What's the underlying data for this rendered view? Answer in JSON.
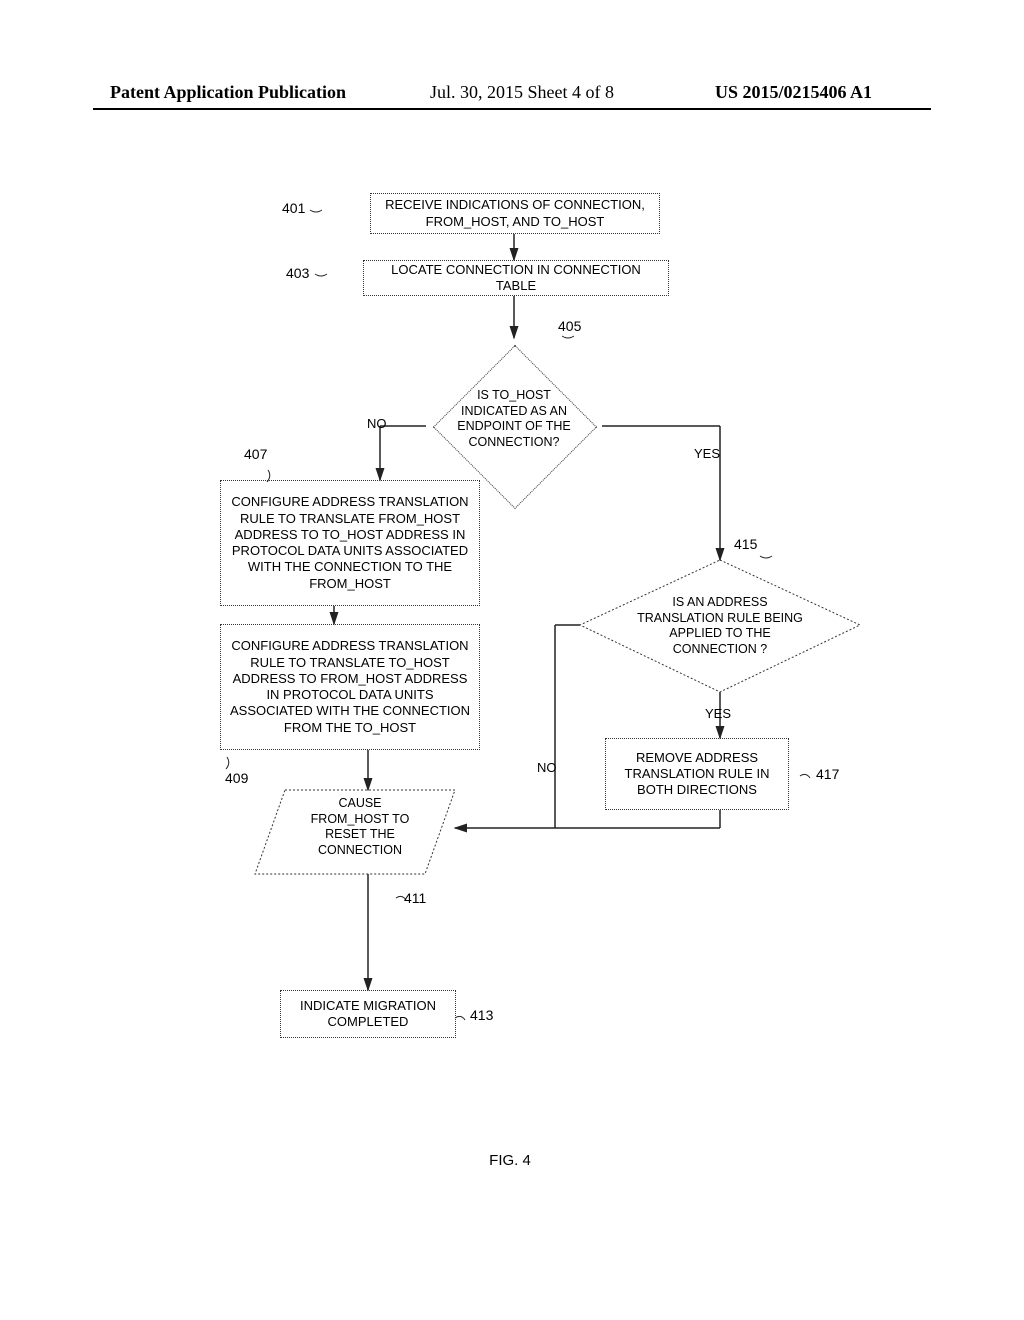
{
  "header": {
    "left": "Patent Application Publication",
    "mid": "Jul. 30, 2015  Sheet 4 of 8",
    "right": "US 2015/0215406 A1"
  },
  "refs": {
    "r401": "401",
    "r403": "403",
    "r405": "405",
    "r407": "407",
    "r409": "409",
    "r411": "411",
    "r413": "413",
    "r415": "415",
    "r417": "417"
  },
  "labels": {
    "no1": "NO",
    "yes1": "YES",
    "no2": "NO",
    "yes2": "YES"
  },
  "boxes": {
    "b401": "RECEIVE INDICATIONS OF CONNECTION, FROM_HOST, AND TO_HOST",
    "b403": "LOCATE CONNECTION IN CONNECTION TABLE",
    "b407": "CONFIGURE ADDRESS TRANSLATION RULE TO TRANSLATE FROM_HOST ADDRESS TO TO_HOST ADDRESS IN PROTOCOL DATA UNITS ASSOCIATED WITH THE CONNECTION TO THE FROM_HOST",
    "b409": "CONFIGURE ADDRESS TRANSLATION RULE TO TRANSLATE TO_HOST ADDRESS TO FROM_HOST ADDRESS IN PROTOCOL DATA UNITS ASSOCIATED WITH THE CONNECTION FROM THE TO_HOST",
    "b417": "REMOVE ADDRESS TRANSLATION RULE IN BOTH DIRECTIONS",
    "b413": "INDICATE MIGRATION COMPLETED"
  },
  "decisions": {
    "d405": "IS TO_HOST INDICATED AS AN ENDPOINT OF THE CONNECTION?",
    "d415": "IS AN ADDRESS TRANSLATION RULE BEING APPLIED TO THE CONNECTION ?"
  },
  "parallelogram": {
    "p411": "CAUSE FROM_HOST TO RESET THE CONNECTION"
  },
  "fig": "FIG. 4"
}
